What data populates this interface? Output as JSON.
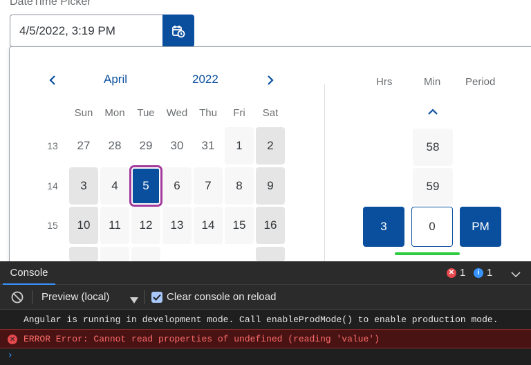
{
  "picker": {
    "label": "DateTime Picker",
    "value": "4/5/2022, 3:19 PM",
    "icon": "calendar-clock-icon"
  },
  "calendar": {
    "month": "April",
    "year": "2022",
    "weekdays": [
      "Sun",
      "Mon",
      "Tue",
      "Wed",
      "Thu",
      "Fri",
      "Sat"
    ],
    "weeks": [
      {
        "num": "13",
        "days": [
          "27",
          "28",
          "29",
          "30",
          "31",
          "1",
          "2"
        ]
      },
      {
        "num": "14",
        "days": [
          "3",
          "4",
          "5",
          "6",
          "7",
          "8",
          "9"
        ]
      },
      {
        "num": "15",
        "days": [
          "10",
          "11",
          "12",
          "13",
          "14",
          "15",
          "16"
        ]
      }
    ],
    "selected_day": "5"
  },
  "time": {
    "headers": {
      "hrs": "Hrs",
      "min": "Min",
      "period": "Period"
    },
    "min_above_2": "58",
    "min_above_1": "59",
    "hours": "3",
    "minutes": "0",
    "period": "PM"
  },
  "console": {
    "tab": "Console",
    "error_count": "1",
    "info_count": "1",
    "preview": "Preview (local)",
    "clear_label": "Clear console on reload",
    "messages": {
      "info": "Angular is running in development mode. Call enableProdMode() to enable production mode.",
      "error": "ERROR Error: Cannot read properties of undefined (reading 'value')"
    }
  },
  "colors": {
    "accent": "#0a4f9e",
    "selection_outline": "#a33a9c",
    "focus_bar": "#2ecc40",
    "error": "#e5484d",
    "info": "#3794ff"
  }
}
